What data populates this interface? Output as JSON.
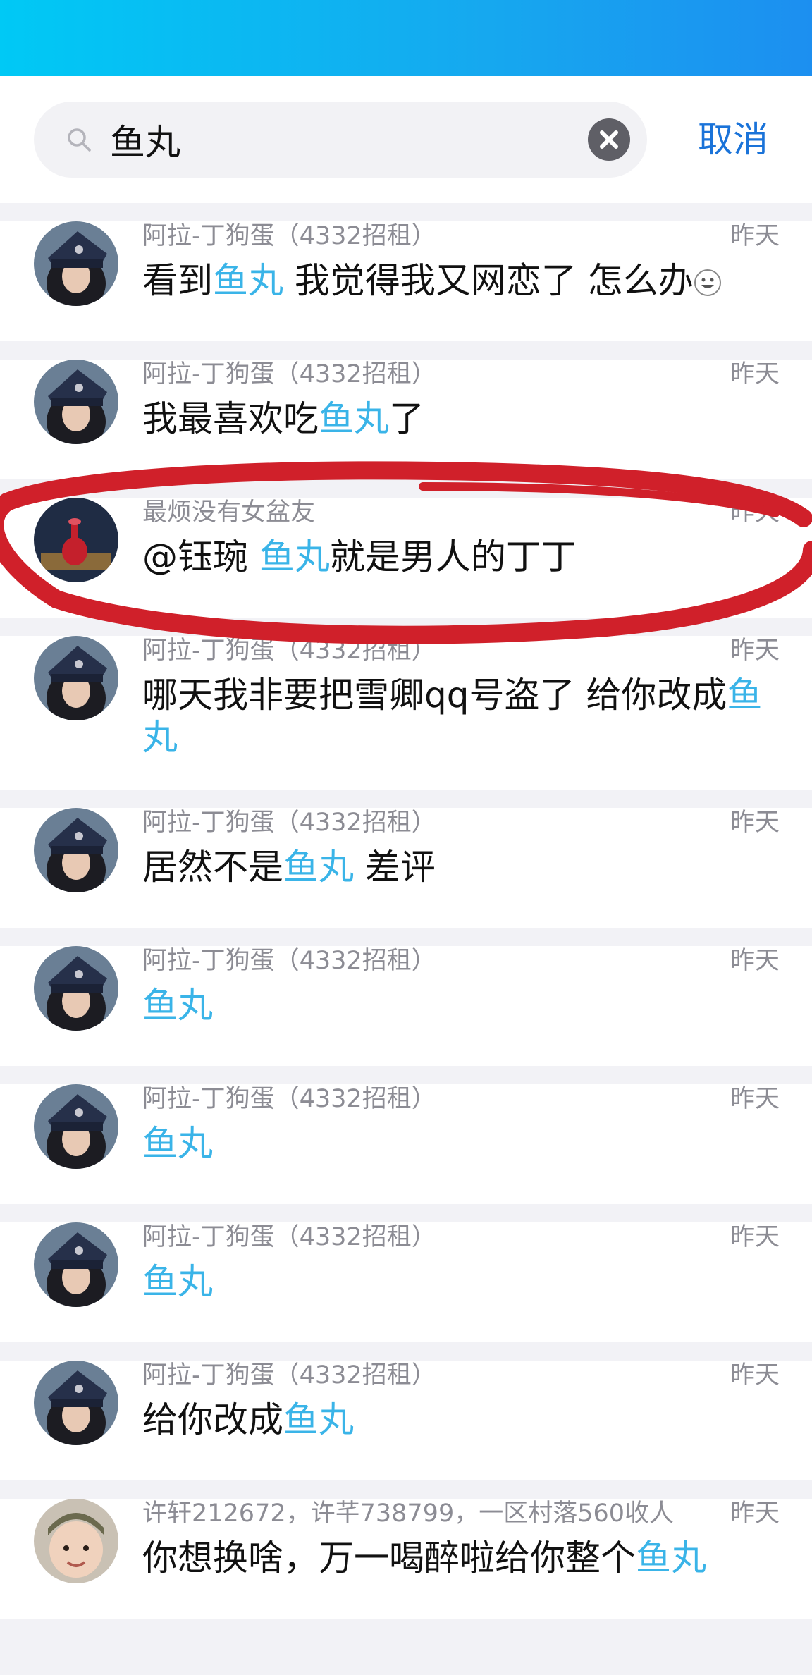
{
  "search": {
    "query": "鱼丸",
    "cancel_label": "取消"
  },
  "colors": {
    "highlight": "#3ab4e8",
    "accent": "#1a73d9",
    "annotation": "#d0202a"
  },
  "results": [
    {
      "sender": "阿拉-丁狗蛋（4332招租）",
      "time": "昨天",
      "avatar": "dark-hat-avatar",
      "parts": [
        {
          "t": "看到"
        },
        {
          "t": "鱼丸",
          "h": true
        },
        {
          "t": " 我觉得我又网恋了 怎么办"
        }
      ],
      "emoji": "grin-emoji"
    },
    {
      "sender": "阿拉-丁狗蛋（4332招租）",
      "time": "昨天",
      "avatar": "dark-hat-avatar",
      "parts": [
        {
          "t": "我最喜欢吃"
        },
        {
          "t": "鱼丸",
          "h": true
        },
        {
          "t": "了"
        }
      ]
    },
    {
      "sender": "最烦没有女盆友",
      "time": "昨天",
      "avatar": "red-vase-avatar",
      "parts": [
        {
          "t": "@钰琬 "
        },
        {
          "t": "鱼丸",
          "h": true
        },
        {
          "t": "就是男人的丁丁"
        }
      ]
    },
    {
      "sender": "阿拉-丁狗蛋（4332招租）",
      "time": "昨天",
      "avatar": "dark-hat-avatar",
      "parts": [
        {
          "t": "哪天我非要把雪卿qq号盗了 给你改成"
        },
        {
          "t": "鱼丸",
          "h": true
        }
      ],
      "tall": true
    },
    {
      "sender": "阿拉-丁狗蛋（4332招租）",
      "time": "昨天",
      "avatar": "dark-hat-avatar",
      "parts": [
        {
          "t": "居然不是"
        },
        {
          "t": "鱼丸",
          "h": true
        },
        {
          "t": " 差评"
        }
      ]
    },
    {
      "sender": "阿拉-丁狗蛋（4332招租）",
      "time": "昨天",
      "avatar": "dark-hat-avatar",
      "parts": [
        {
          "t": "鱼丸",
          "h": true
        }
      ]
    },
    {
      "sender": "阿拉-丁狗蛋（4332招租）",
      "time": "昨天",
      "avatar": "dark-hat-avatar",
      "parts": [
        {
          "t": "鱼丸",
          "h": true
        }
      ]
    },
    {
      "sender": "阿拉-丁狗蛋（4332招租）",
      "time": "昨天",
      "avatar": "dark-hat-avatar",
      "parts": [
        {
          "t": "鱼丸",
          "h": true
        }
      ]
    },
    {
      "sender": "阿拉-丁狗蛋（4332招租）",
      "time": "昨天",
      "avatar": "dark-hat-avatar",
      "parts": [
        {
          "t": "给你改成"
        },
        {
          "t": "鱼丸",
          "h": true
        }
      ]
    },
    {
      "sender": "许轩212672，许芊738799，一区村落560收人",
      "time": "昨天",
      "avatar": "baby-avatar",
      "parts": [
        {
          "t": "你想换啥，万一喝醉啦给你整个"
        },
        {
          "t": "鱼丸",
          "h": true
        }
      ]
    }
  ]
}
